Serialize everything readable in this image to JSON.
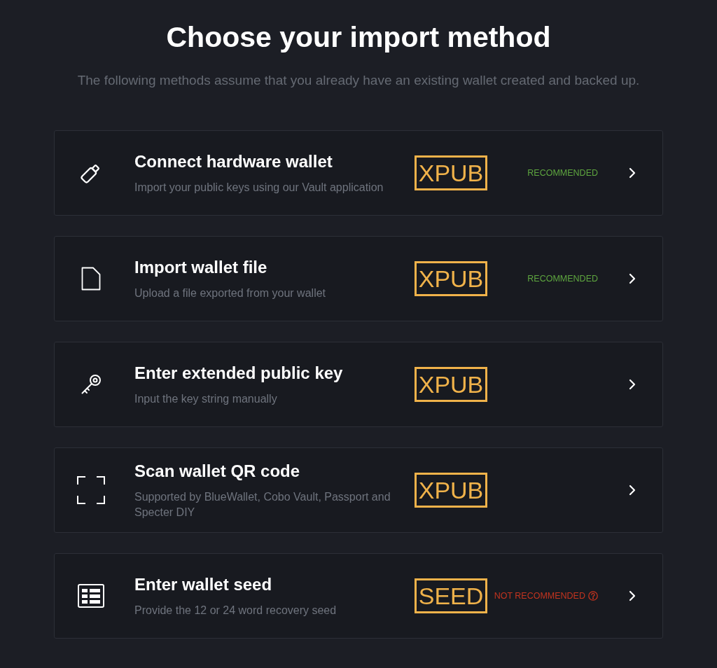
{
  "header": {
    "title": "Choose your import method",
    "subtitle": "The following methods assume that you already have an existing wallet created and backed up."
  },
  "methods": [
    {
      "kind": "hardware",
      "title": "Connect hardware wallet",
      "description": "Import your public keys using our Vault application",
      "tag": "XPUB",
      "status": {
        "kind": "positive",
        "label": "RECOMMENDED"
      }
    },
    {
      "kind": "file",
      "title": "Import wallet file",
      "description": "Upload a file exported from your wallet",
      "tag": "XPUB",
      "status": {
        "kind": "positive",
        "label": "RECOMMENDED"
      }
    },
    {
      "kind": "key",
      "title": "Enter extended public key",
      "description": "Input the key string manually",
      "tag": "XPUB"
    },
    {
      "kind": "qr",
      "title": "Scan wallet QR code",
      "description": "Supported by BlueWallet, Cobo Vault, Passport and Specter DIY",
      "tag": "XPUB"
    },
    {
      "kind": "seed",
      "title": "Enter wallet seed",
      "description": "Provide the 12 or 24 word recovery seed",
      "tag": "SEED",
      "status": {
        "kind": "negative",
        "label": "NOT RECOMMENDED"
      }
    }
  ]
}
